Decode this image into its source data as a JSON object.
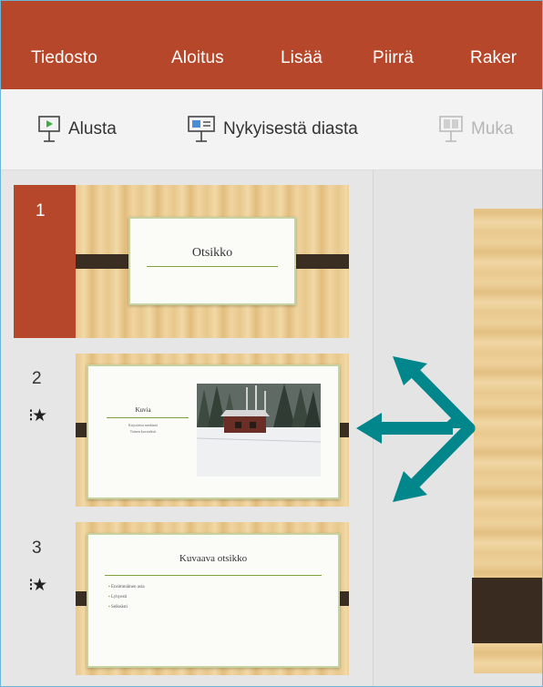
{
  "ribbon": {
    "tabs": [
      "Tiedosto",
      "Aloitus",
      "Lisää",
      "Piirrä",
      "Raker"
    ]
  },
  "toolbar": {
    "from_start": "Alusta",
    "from_current": "Nykyisestä diasta",
    "custom": "Muka"
  },
  "slides": [
    {
      "number": "1",
      "title": "Otsikko",
      "selected": true
    },
    {
      "number": "2",
      "title": "Kuvia",
      "subtitle_lines": [
        "Kirjoitettu merkintä",
        "Toinen kuvateksti"
      ],
      "has_animation": true
    },
    {
      "number": "3",
      "title": "Kuvaava otsikko",
      "bullets": [
        "Ensimmäinen asia",
        "Lyhyesti",
        "Selkeästi"
      ],
      "has_animation": true
    }
  ],
  "animation_icon": "animation-star-icon",
  "colors": {
    "accent": "#b7472a",
    "arrow": "#00868b"
  }
}
